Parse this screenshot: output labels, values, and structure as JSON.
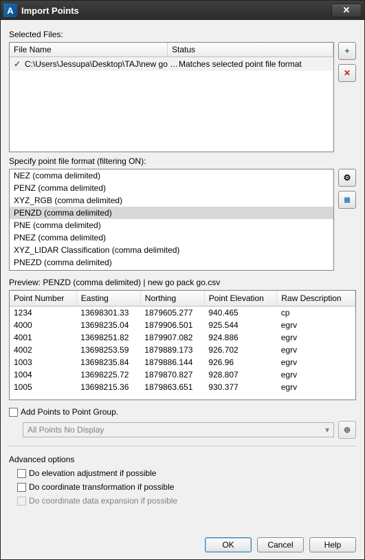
{
  "window": {
    "title": "Import Points"
  },
  "sections": {
    "selected_files": "Selected Files:",
    "specify_format": "Specify point file format (filtering ON):"
  },
  "files": {
    "headers": [
      "File Name",
      "Status"
    ],
    "rows": [
      {
        "name": "C:\\Users\\Jessupa\\Desktop\\TAJ\\new go p...",
        "status": "Matches selected point file format"
      }
    ]
  },
  "formats": {
    "selected_index": 3,
    "items": [
      "NEZ (comma delimited)",
      "PENZ (comma delimited)",
      "XYZ_RGB (comma delimited)",
      "PENZD (comma delimited)",
      "PNE (comma delimited)",
      "PNEZ (comma delimited)",
      "XYZ_LIDAR Classification (comma delimited)",
      "PNEZD (comma delimited)"
    ]
  },
  "preview": {
    "label": "Preview: PENZD (comma delimited) | new go pack go.csv",
    "headers": [
      "Point Number",
      "Easting",
      "Northing",
      "Point Elevation",
      "Raw Description"
    ],
    "rows": [
      [
        "1234",
        "13698301.33",
        "1879605.277",
        "940.465",
        "cp"
      ],
      [
        "4000",
        "13698235.04",
        "1879906.501",
        "925.544",
        "egrv"
      ],
      [
        "4001",
        "13698251.82",
        "1879907.082",
        "924.886",
        "egrv"
      ],
      [
        "4002",
        "13698253.59",
        "1879889.173",
        "926.702",
        "egrv"
      ],
      [
        "1003",
        "13698235.84",
        "1879886.144",
        "926.96",
        "egrv"
      ],
      [
        "1004",
        "13698225.72",
        "1879870.827",
        "928.807",
        "egrv"
      ],
      [
        "1005",
        "13698215.36",
        "1879863.651",
        "930.377",
        "egrv"
      ]
    ]
  },
  "point_group": {
    "label": "Add Points to Point Group.",
    "value": "All Points No Display",
    "checked": false
  },
  "advanced": {
    "label": "Advanced options",
    "items": [
      "Do elevation adjustment if possible",
      "Do coordinate transformation if possible",
      "Do coordinate data expansion if possible"
    ],
    "checked": [
      false,
      false,
      false
    ],
    "enabled": [
      true,
      true,
      false
    ]
  },
  "buttons": {
    "ok": "OK",
    "cancel": "Cancel",
    "help": "Help"
  }
}
